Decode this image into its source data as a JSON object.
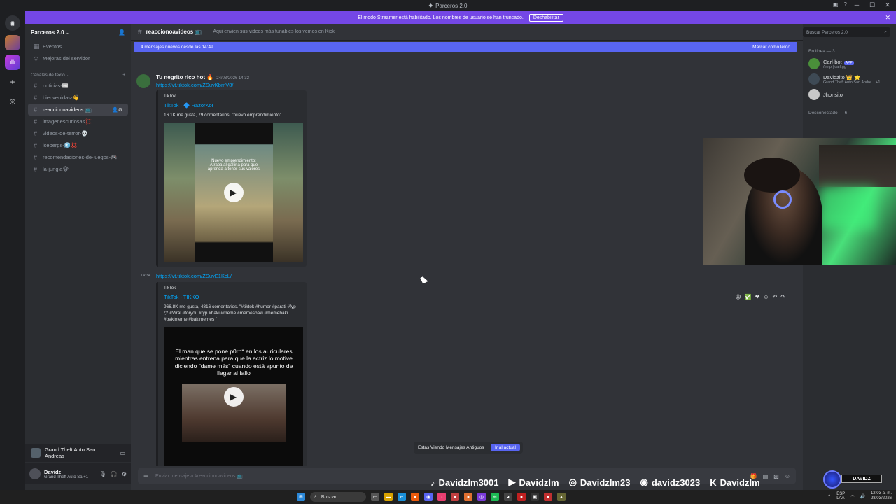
{
  "window": {
    "title": "Parceros 2.0"
  },
  "banner": {
    "text": "El modo Streamer está habilitado. Los nombres de usuario se han truncado.",
    "button": "Deshabilitar"
  },
  "server": {
    "name": "Parceros 2.0"
  },
  "sidebar": {
    "top_items": [
      {
        "label": "Eventos",
        "icon": "calendar-icon"
      },
      {
        "label": "Mejoras del servidor",
        "icon": "boost-icon"
      }
    ],
    "category": "Canales de texto",
    "channels": [
      {
        "label": "noticias-📰"
      },
      {
        "label": "bienvenidas-👋"
      },
      {
        "label": "reaccionoavideos 📺",
        "active": true
      },
      {
        "label": "imagenescuriosas💢"
      },
      {
        "label": "videos-de-terror-💀"
      },
      {
        "label": "icebergs-🧊💢"
      },
      {
        "label": "recomendaciones-de-juegos-🎮"
      },
      {
        "label": "la-jungla🐵"
      }
    ]
  },
  "voice_bar": {
    "label": "Grand Theft Auto San Andreas"
  },
  "user": {
    "name": "Davidz",
    "status": "Grand Theft Auto Sa +1"
  },
  "channel": {
    "name": "reaccionoavideos 📺",
    "topic": "Aqui envien sus videos más funables los vemos en Kick"
  },
  "new_messages": {
    "text": "4 mensajes nuevos desde las 14:49",
    "action": "Marcar como leído"
  },
  "messages": [
    {
      "author": "Tu negrito rico hot 🔥",
      "time": "24/03/2026 14:32",
      "link": "https://vt.tiktok.com/ZSuvKbmV8/",
      "embed": {
        "provider": "TikTok",
        "title": "TikTok · 🔷 RazorKor",
        "desc": "16.1K me gusta, 79 comentarios. \"nuevo emprendimiento\"",
        "caption": "Nuevo emprendimiento: Atrapa al gallina para que aprenda a tener sus valores"
      }
    },
    {
      "side_time": "14:34",
      "link": "https://vt.tiktok.com/ZSuvE1KcL/",
      "embed": {
        "provider": "TikTok",
        "title": "TikTok · TIKKO",
        "desc": "966.8K me gusta, 4816 comentarios. \"#tiktok #humor #parati #fyp ツ #Viral #foryou #fyp #baki #meme #memesbaki #memebaki #bakimeme #bakimemes \"",
        "caption": "El man que se pone p0rn* en los auriculares mientras entrena para que la actriz lo motive diciendo \"dame más\" cuando está apunto de llegar al fallo"
      }
    }
  ],
  "jump_bar": {
    "text": "Estás Viendo Mensajes Antiguos",
    "button": "Ir al actual"
  },
  "composer": {
    "placeholder": "Enviar mensaje a #reaccionoavideos 📺"
  },
  "search": {
    "placeholder": "Buscar Parceros 2.0"
  },
  "members": {
    "online_header": "En línea — 3",
    "online": [
      {
        "name": "Carl-bot",
        "badge": "APP",
        "sub": "/help | carl.gg"
      },
      {
        "name": "Davidzito 👑 ⭐",
        "sub": "Grand Theft Auto San Andre... +1"
      },
      {
        "name": "Jhonsito",
        "sub": ""
      }
    ],
    "offline_header": "Desconectado — 6"
  },
  "socials": [
    {
      "icon": "tiktok-icon",
      "label": "Davidzlm3001"
    },
    {
      "icon": "youtube-icon",
      "label": "Davidzlm"
    },
    {
      "icon": "instagram-icon",
      "label": "Davidzlm23"
    },
    {
      "icon": "discord-icon",
      "label": "davidz3023"
    },
    {
      "icon": "kick-icon",
      "label": "Davidzlm"
    }
  ],
  "badge_label": "DAVIDZ",
  "taskbar": {
    "search": "Buscar",
    "lang": "ESP\nLAA",
    "time": "12:03 a. m.",
    "date": "28/03/2026"
  }
}
